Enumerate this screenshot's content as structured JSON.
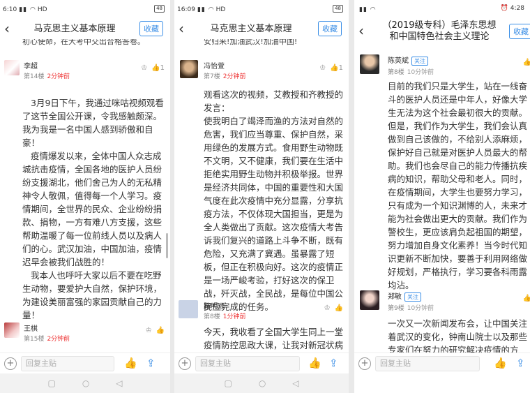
{
  "panels": [
    {
      "status": {
        "time": "6:10",
        "signal": "ṊṊ",
        "network": "HD",
        "battery": "48"
      },
      "title": "马克思主义基本原理",
      "fav_label": "收藏",
      "top_fragment": "初心使命，在大考中交出合格答卷。",
      "posts": [
        {
          "name": "李超",
          "floor": "第14楼",
          "time": "2分钟前",
          "likes": "1",
          "paragraphs": [
            "3月9日下午，我通过咪咕视频观看了这节全国公开课，令我感触颇深。我为我是一名中国人感到骄傲和自豪！",
            "疫情爆发以来，全体中国人众志成城抗击疫情，全国各地的医护人员纷纷支援湖北，他们舍己为人的无私精神令人敬佩，值得每一个人学习。疫情期间，全世界的民众、企业纷纷捐款、捐物，一方有难八方支援，这些帮助温暖了每一位前线人员以及病人们的心。武汉加油，中国加油，疫情迟早会被我们战胜的！",
            "我本人也呼吁大家以后不要在吃野生动物，要爱护大自然，保护环境，为建设美丽富强的家园贡献自己的力量！"
          ]
        },
        {
          "name": "王棋",
          "floor": "第15楼",
          "time": "2分钟前"
        }
      ],
      "reply_placeholder": "回复主贴"
    },
    {
      "status": {
        "time": "16:09",
        "signal": "ṊṊ",
        "network": "HD",
        "battery": "48"
      },
      "title": "马克思主义基本原理",
      "fav_label": "收藏",
      "top_fragment": "安归来!加油武汉!加油中国!",
      "posts": [
        {
          "name": "冯怡萱",
          "floor": "第7楼",
          "time": "2分钟前",
          "likes": "1",
          "paragraphs": [
            "观看这次的视频，艾教授和齐教授的发言：",
            "使我明白了竭泽而渔的方法对自然的危害，我们应当尊重、保护自然，采用绿色的发展方式。食用野生动物既不文明，又不健康，我们要在生活中拒绝实用野生动物并积极举报。世界是经济共同体，中国的重要性和大国气度在此次疫情中充分显露，分享抗疫方法，不仅体现大国担当，更是为全人类做出了贡献。这次疫情大考告诉我们复兴的道路上斗争不断，既有危险，又充满了冀遇。虽暴露了短板，但正在积极向好。这次的疫情正是一场严峻考验，打好这次的保卫战，歼灭战，全民战，是每位中国公民应完成的任务。"
          ]
        },
        {
          "name": "路明远",
          "floor": "第8楼",
          "time": "1分钟前",
          "paragraphs": [
            "今天，我收看了全国大学生同上一堂疫情防控思政大课，让我对新冠状病毒"
          ]
        }
      ],
      "reply_placeholder": "回复主贴"
    },
    {
      "status": {
        "time": "4:28",
        "signal": "ṊṊ",
        "network": "",
        "battery": ""
      },
      "title": "（2019级专科）毛泽东思想和中国特色社会主义理论",
      "fav_label": "收藏",
      "posts": [
        {
          "name": "陈英斌",
          "follow": "关注",
          "floor": "第8楼",
          "time": "10分钟前",
          "paragraphs": [
            "目前的我们只是大学生，站在一线奋斗的医护人员还是中年人，好像大学生无法为这个社会最初很大的贡献。但是，我们作为大学生，我们会认真做到自己该做的，不给别人添麻烦，保护好自己就是对医护人员最大的帮助。我们也会尽自己的能力传播抗疾病的知识，帮助父母和老人。同时，在疫情期间，大学生也要努力学习，只有成为一个知识渊博的人，未来才能为社会做出更大的贡献。我们作为警校生，更应该肩负起祖国的期望，努力增加自身文化素养！当今时代知识更新不断加快，要善于利用网络做好规划，严格执行，学习要各科雨露均沾。"
          ]
        },
        {
          "name": "郑敏",
          "follow": "关注",
          "floor": "第9楼",
          "time": "10分钟前",
          "paragraphs": [
            "一次又一次新闻发布会，让中国关注着武汉的变化，钟南山院士以及那些专家们在努力的研究解决疫情的方案，人们的付出只为了打赢这场战，再"
          ]
        }
      ],
      "reply_placeholder": "回复主贴"
    }
  ],
  "icons": {
    "back": "chevron-left-icon",
    "like": "thumb-up-icon",
    "share": "share-icon",
    "plus": "plus-circle-icon"
  }
}
